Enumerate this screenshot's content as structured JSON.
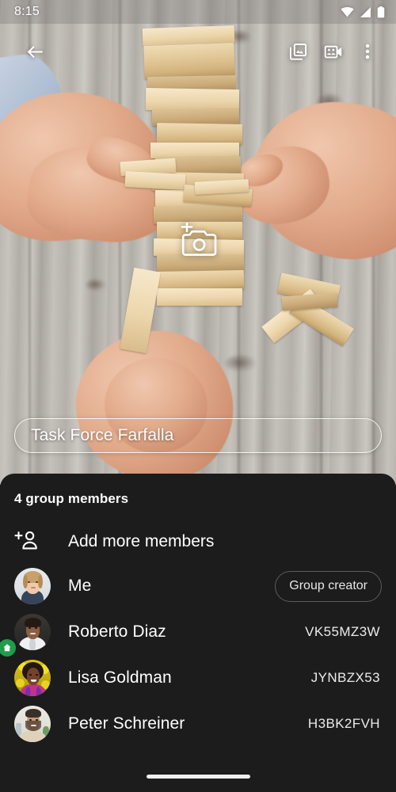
{
  "status_bar": {
    "time": "8:15",
    "icons": [
      "wifi-icon",
      "cellular-signal-icon",
      "battery-icon"
    ]
  },
  "app_bar": {
    "back_icon": "arrow-back-icon",
    "gallery_icon": "photo-library-icon",
    "video_icon": "group-video-call-icon",
    "overflow_icon": "more-vert-icon"
  },
  "hero": {
    "add_photo_icon": "add-a-photo-icon",
    "group_name": "Task Force Farfalla"
  },
  "sheet": {
    "title": "4 group members",
    "add_members": {
      "label": "Add more members",
      "icon": "person-add-icon"
    },
    "members": [
      {
        "name": "Me",
        "code": "",
        "chip": "Group creator",
        "avatar": "avatar-me",
        "badge": ""
      },
      {
        "name": "Roberto Diaz",
        "code": "VK55MZ3W",
        "chip": "",
        "avatar": "avatar-roberto-diaz",
        "badge": "home-badge-icon"
      },
      {
        "name": "Lisa Goldman",
        "code": "JYNBZX53",
        "chip": "",
        "avatar": "avatar-lisa-goldman",
        "badge": ""
      },
      {
        "name": "Peter Schreiner",
        "code": "H3BK2FVH",
        "chip": "",
        "avatar": "avatar-peter-schreiner",
        "badge": ""
      }
    ]
  },
  "nav_bar": {
    "pill": "home-gesture-pill"
  },
  "colors": {
    "sheet_background": "#1c1c1c",
    "page_background": "#1b1b1b",
    "badge_green": "#1e9e4a",
    "text_primary": "#ffffff",
    "chip_border": "#5c5c5c"
  }
}
